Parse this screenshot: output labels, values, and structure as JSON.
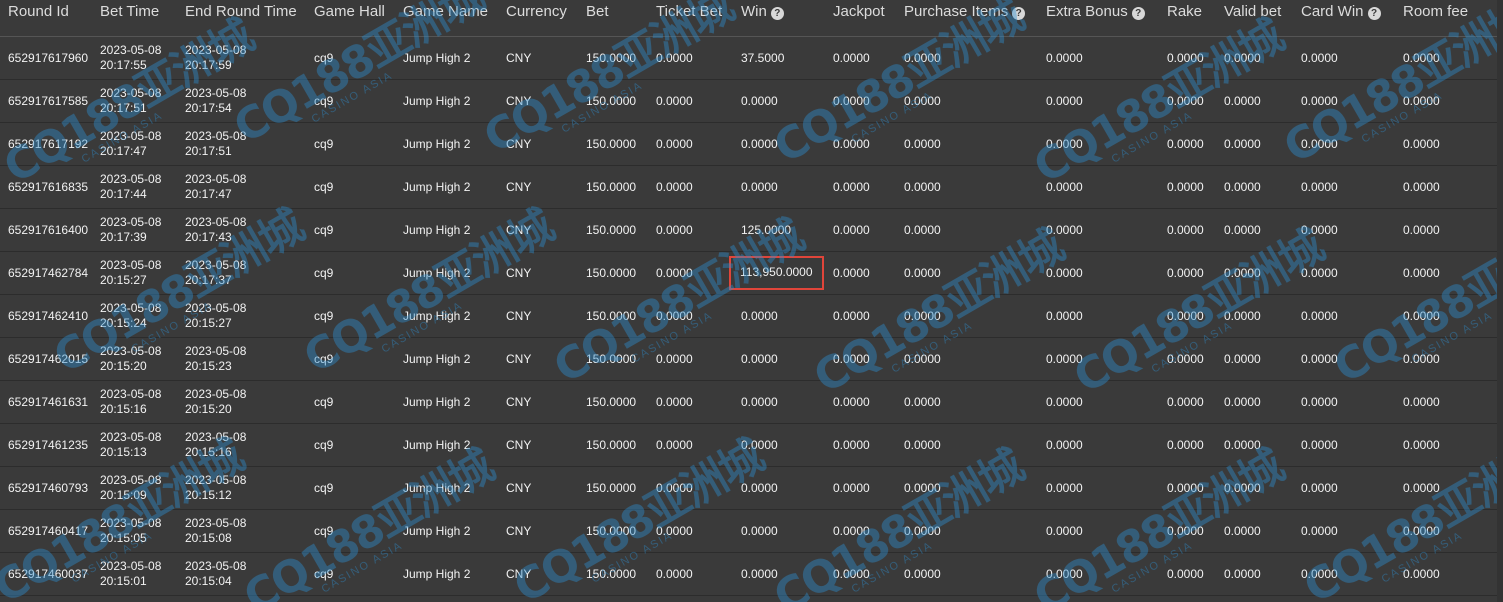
{
  "columns": [
    {
      "label": "Round Id",
      "help": false
    },
    {
      "label": "Bet Time",
      "help": false
    },
    {
      "label": "End Round Time",
      "help": false
    },
    {
      "label": "Game Hall",
      "help": false
    },
    {
      "label": "Game Name",
      "help": false
    },
    {
      "label": "Currency",
      "help": false
    },
    {
      "label": "Bet",
      "help": false
    },
    {
      "label": "Ticket Bet",
      "help": false
    },
    {
      "label": "Win",
      "help": true
    },
    {
      "label": "Jackpot",
      "help": false
    },
    {
      "label": "Purchase Items",
      "help": true
    },
    {
      "label": "Extra Bonus",
      "help": true
    },
    {
      "label": "Rake",
      "help": false
    },
    {
      "label": "Valid bet",
      "help": false
    },
    {
      "label": "Card Win",
      "help": true
    },
    {
      "label": "Room fee",
      "help": false
    }
  ],
  "help_glyph": "?",
  "rows": [
    {
      "round_id": "652917617960",
      "bet_date": "2023-05-08",
      "bet_time": "20:17:55",
      "end_date": "2023-05-08",
      "end_time": "20:17:59",
      "hall": "cq9",
      "game": "Jump High 2",
      "currency": "CNY",
      "bet": "150.0000",
      "ticket_bet": "0.0000",
      "win": "37.5000",
      "jackpot": "0.0000",
      "purchase": "0.0000",
      "extra_bonus": "0.0000",
      "rake": "0.0000",
      "valid_bet": "0.0000",
      "card_win": "0.0000",
      "room_fee": "0.0000"
    },
    {
      "round_id": "652917617585",
      "bet_date": "2023-05-08",
      "bet_time": "20:17:51",
      "end_date": "2023-05-08",
      "end_time": "20:17:54",
      "hall": "cq9",
      "game": "Jump High 2",
      "currency": "CNY",
      "bet": "150.0000",
      "ticket_bet": "0.0000",
      "win": "0.0000",
      "jackpot": "0.0000",
      "purchase": "0.0000",
      "extra_bonus": "0.0000",
      "rake": "0.0000",
      "valid_bet": "0.0000",
      "card_win": "0.0000",
      "room_fee": "0.0000"
    },
    {
      "round_id": "652917617192",
      "bet_date": "2023-05-08",
      "bet_time": "20:17:47",
      "end_date": "2023-05-08",
      "end_time": "20:17:51",
      "hall": "cq9",
      "game": "Jump High 2",
      "currency": "CNY",
      "bet": "150.0000",
      "ticket_bet": "0.0000",
      "win": "0.0000",
      "jackpot": "0.0000",
      "purchase": "0.0000",
      "extra_bonus": "0.0000",
      "rake": "0.0000",
      "valid_bet": "0.0000",
      "card_win": "0.0000",
      "room_fee": "0.0000"
    },
    {
      "round_id": "652917616835",
      "bet_date": "2023-05-08",
      "bet_time": "20:17:44",
      "end_date": "2023-05-08",
      "end_time": "20:17:47",
      "hall": "cq9",
      "game": "Jump High 2",
      "currency": "CNY",
      "bet": "150.0000",
      "ticket_bet": "0.0000",
      "win": "0.0000",
      "jackpot": "0.0000",
      "purchase": "0.0000",
      "extra_bonus": "0.0000",
      "rake": "0.0000",
      "valid_bet": "0.0000",
      "card_win": "0.0000",
      "room_fee": "0.0000"
    },
    {
      "round_id": "652917616400",
      "bet_date": "2023-05-08",
      "bet_time": "20:17:39",
      "end_date": "2023-05-08",
      "end_time": "20:17:43",
      "hall": "cq9",
      "game": "Jump High 2",
      "currency": "CNY",
      "bet": "150.0000",
      "ticket_bet": "0.0000",
      "win": "125.0000",
      "jackpot": "0.0000",
      "purchase": "0.0000",
      "extra_bonus": "0.0000",
      "rake": "0.0000",
      "valid_bet": "0.0000",
      "card_win": "0.0000",
      "room_fee": "0.0000"
    },
    {
      "round_id": "652917462784",
      "bet_date": "2023-05-08",
      "bet_time": "20:15:27",
      "end_date": "2023-05-08",
      "end_time": "20:17:37",
      "hall": "cq9",
      "game": "Jump High 2",
      "currency": "CNY",
      "bet": "150.0000",
      "ticket_bet": "0.0000",
      "win": "113,950.0000",
      "highlight": true,
      "jackpot": "0.0000",
      "purchase": "0.0000",
      "extra_bonus": "0.0000",
      "rake": "0.0000",
      "valid_bet": "0.0000",
      "card_win": "0.0000",
      "room_fee": "0.0000"
    },
    {
      "round_id": "652917462410",
      "bet_date": "2023-05-08",
      "bet_time": "20:15:24",
      "end_date": "2023-05-08",
      "end_time": "20:15:27",
      "hall": "cq9",
      "game": "Jump High 2",
      "currency": "CNY",
      "bet": "150.0000",
      "ticket_bet": "0.0000",
      "win": "0.0000",
      "jackpot": "0.0000",
      "purchase": "0.0000",
      "extra_bonus": "0.0000",
      "rake": "0.0000",
      "valid_bet": "0.0000",
      "card_win": "0.0000",
      "room_fee": "0.0000"
    },
    {
      "round_id": "652917462015",
      "bet_date": "2023-05-08",
      "bet_time": "20:15:20",
      "end_date": "2023-05-08",
      "end_time": "20:15:23",
      "hall": "cq9",
      "game": "Jump High 2",
      "currency": "CNY",
      "bet": "150.0000",
      "ticket_bet": "0.0000",
      "win": "0.0000",
      "jackpot": "0.0000",
      "purchase": "0.0000",
      "extra_bonus": "0.0000",
      "rake": "0.0000",
      "valid_bet": "0.0000",
      "card_win": "0.0000",
      "room_fee": "0.0000"
    },
    {
      "round_id": "652917461631",
      "bet_date": "2023-05-08",
      "bet_time": "20:15:16",
      "end_date": "2023-05-08",
      "end_time": "20:15:20",
      "hall": "cq9",
      "game": "Jump High 2",
      "currency": "CNY",
      "bet": "150.0000",
      "ticket_bet": "0.0000",
      "win": "0.0000",
      "jackpot": "0.0000",
      "purchase": "0.0000",
      "extra_bonus": "0.0000",
      "rake": "0.0000",
      "valid_bet": "0.0000",
      "card_win": "0.0000",
      "room_fee": "0.0000"
    },
    {
      "round_id": "652917461235",
      "bet_date": "2023-05-08",
      "bet_time": "20:15:13",
      "end_date": "2023-05-08",
      "end_time": "20:15:16",
      "hall": "cq9",
      "game": "Jump High 2",
      "currency": "CNY",
      "bet": "150.0000",
      "ticket_bet": "0.0000",
      "win": "0.0000",
      "jackpot": "0.0000",
      "purchase": "0.0000",
      "extra_bonus": "0.0000",
      "rake": "0.0000",
      "valid_bet": "0.0000",
      "card_win": "0.0000",
      "room_fee": "0.0000"
    },
    {
      "round_id": "652917460793",
      "bet_date": "2023-05-08",
      "bet_time": "20:15:09",
      "end_date": "2023-05-08",
      "end_time": "20:15:12",
      "hall": "cq9",
      "game": "Jump High 2",
      "currency": "CNY",
      "bet": "150.0000",
      "ticket_bet": "0.0000",
      "win": "0.0000",
      "jackpot": "0.0000",
      "purchase": "0.0000",
      "extra_bonus": "0.0000",
      "rake": "0.0000",
      "valid_bet": "0.0000",
      "card_win": "0.0000",
      "room_fee": "0.0000"
    },
    {
      "round_id": "652917460417",
      "bet_date": "2023-05-08",
      "bet_time": "20:15:05",
      "end_date": "2023-05-08",
      "end_time": "20:15:08",
      "hall": "cq9",
      "game": "Jump High 2",
      "currency": "CNY",
      "bet": "150.0000",
      "ticket_bet": "0.0000",
      "win": "0.0000",
      "jackpot": "0.0000",
      "purchase": "0.0000",
      "extra_bonus": "0.0000",
      "rake": "0.0000",
      "valid_bet": "0.0000",
      "card_win": "0.0000",
      "room_fee": "0.0000"
    },
    {
      "round_id": "652917460037",
      "bet_date": "2023-05-08",
      "bet_time": "20:15:01",
      "end_date": "2023-05-08",
      "end_time": "20:15:04",
      "hall": "cq9",
      "game": "Jump High 2",
      "currency": "CNY",
      "bet": "150.0000",
      "ticket_bet": "0.0000",
      "win": "0.0000",
      "jackpot": "0.0000",
      "purchase": "0.0000",
      "extra_bonus": "0.0000",
      "rake": "0.0000",
      "valid_bet": "0.0000",
      "card_win": "0.0000",
      "room_fee": "0.0000"
    }
  ],
  "watermark": {
    "logo": "CQ188",
    "chinese": "亚洲城",
    "sub": "CASINO ASIA",
    "color": "#2e8fd0"
  },
  "colors": {
    "background": "#3a3a3a",
    "header_text": "#dcdcdc",
    "cell_text": "#f2f2f2",
    "highlight_border": "#e0453a"
  }
}
